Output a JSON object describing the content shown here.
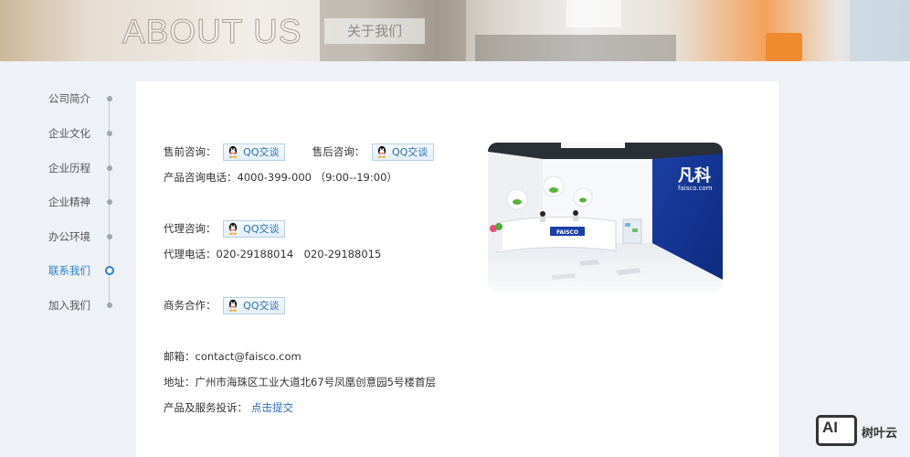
{
  "banner": {
    "title": "ABOUT US",
    "subtitle": "关于我们"
  },
  "sidebar": {
    "items": [
      {
        "label": "公司简介",
        "active": false
      },
      {
        "label": "企业文化",
        "active": false
      },
      {
        "label": "企业历程",
        "active": false
      },
      {
        "label": "企业精神",
        "active": false
      },
      {
        "label": "办公环境",
        "active": false
      },
      {
        "label": "联系我们",
        "active": true
      },
      {
        "label": "加入我们",
        "active": false
      }
    ]
  },
  "contact": {
    "presale_label": "售前咨询：",
    "aftersale_label": "售后咨询：",
    "qq_label": "QQ交谈",
    "phone": "产品咨询电话：4000-399-000 （9:00--19:00）",
    "agent_label": "代理咨询：",
    "agent_phone": "代理电话：020-29188014　020-29188015",
    "business_label": "商务合作：",
    "email": "邮箱：contact@faisco.com",
    "address": "地址：广州市海珠区工业大道北67号凤凰创意园5号楼首层",
    "complaint_label": "产品及服务投诉：",
    "complaint_link": "点击提交"
  },
  "photo": {
    "wall_brand": "凡科",
    "wall_site": "faisco.com",
    "desk_logo": "FAISCO"
  },
  "watermark": {
    "logo_text": "AI",
    "text": "树叶云"
  },
  "colors": {
    "accent": "#2b7fc4",
    "link": "#2b6eb0",
    "background": "#eef1f5"
  }
}
